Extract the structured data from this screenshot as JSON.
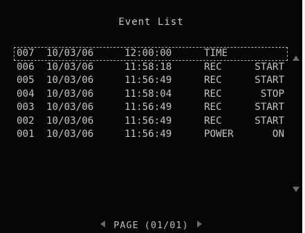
{
  "screen": {
    "title": "Event List"
  },
  "events": [
    {
      "num": "007",
      "date": "10/03/06",
      "time": "12:00:00",
      "event": "TIME",
      "event_state": "",
      "selected": true
    },
    {
      "num": "006",
      "date": "10/03/06",
      "time": "11:58:18",
      "event": "REC",
      "event_state": "START",
      "selected": false
    },
    {
      "num": "005",
      "date": "10/03/06",
      "time": "11:56:49",
      "event": "REC",
      "event_state": "START",
      "selected": false
    },
    {
      "num": "004",
      "date": "10/03/06",
      "time": "11:58:04",
      "event": "REC",
      "event_state": "STOP",
      "selected": false
    },
    {
      "num": "003",
      "date": "10/03/06",
      "time": "11:56:49",
      "event": "REC",
      "event_state": "START",
      "selected": false
    },
    {
      "num": "002",
      "date": "10/03/06",
      "time": "11:56:49",
      "event": "REC",
      "event_state": "START",
      "selected": false
    },
    {
      "num": "001",
      "date": "10/03/06",
      "time": "11:56:49",
      "event": "POWER",
      "event_state": "ON",
      "selected": false
    }
  ],
  "pager": {
    "label": "PAGE",
    "value": "(01/01)"
  },
  "icons": {
    "scroll_up": "triangle-up-icon",
    "scroll_down": "triangle-down-icon",
    "prev_page": "triangle-left-icon",
    "next_page": "triangle-right-icon"
  },
  "colors": {
    "background": "#060606",
    "text": "#c4c4c4",
    "arrow": "#6a6a6a"
  }
}
